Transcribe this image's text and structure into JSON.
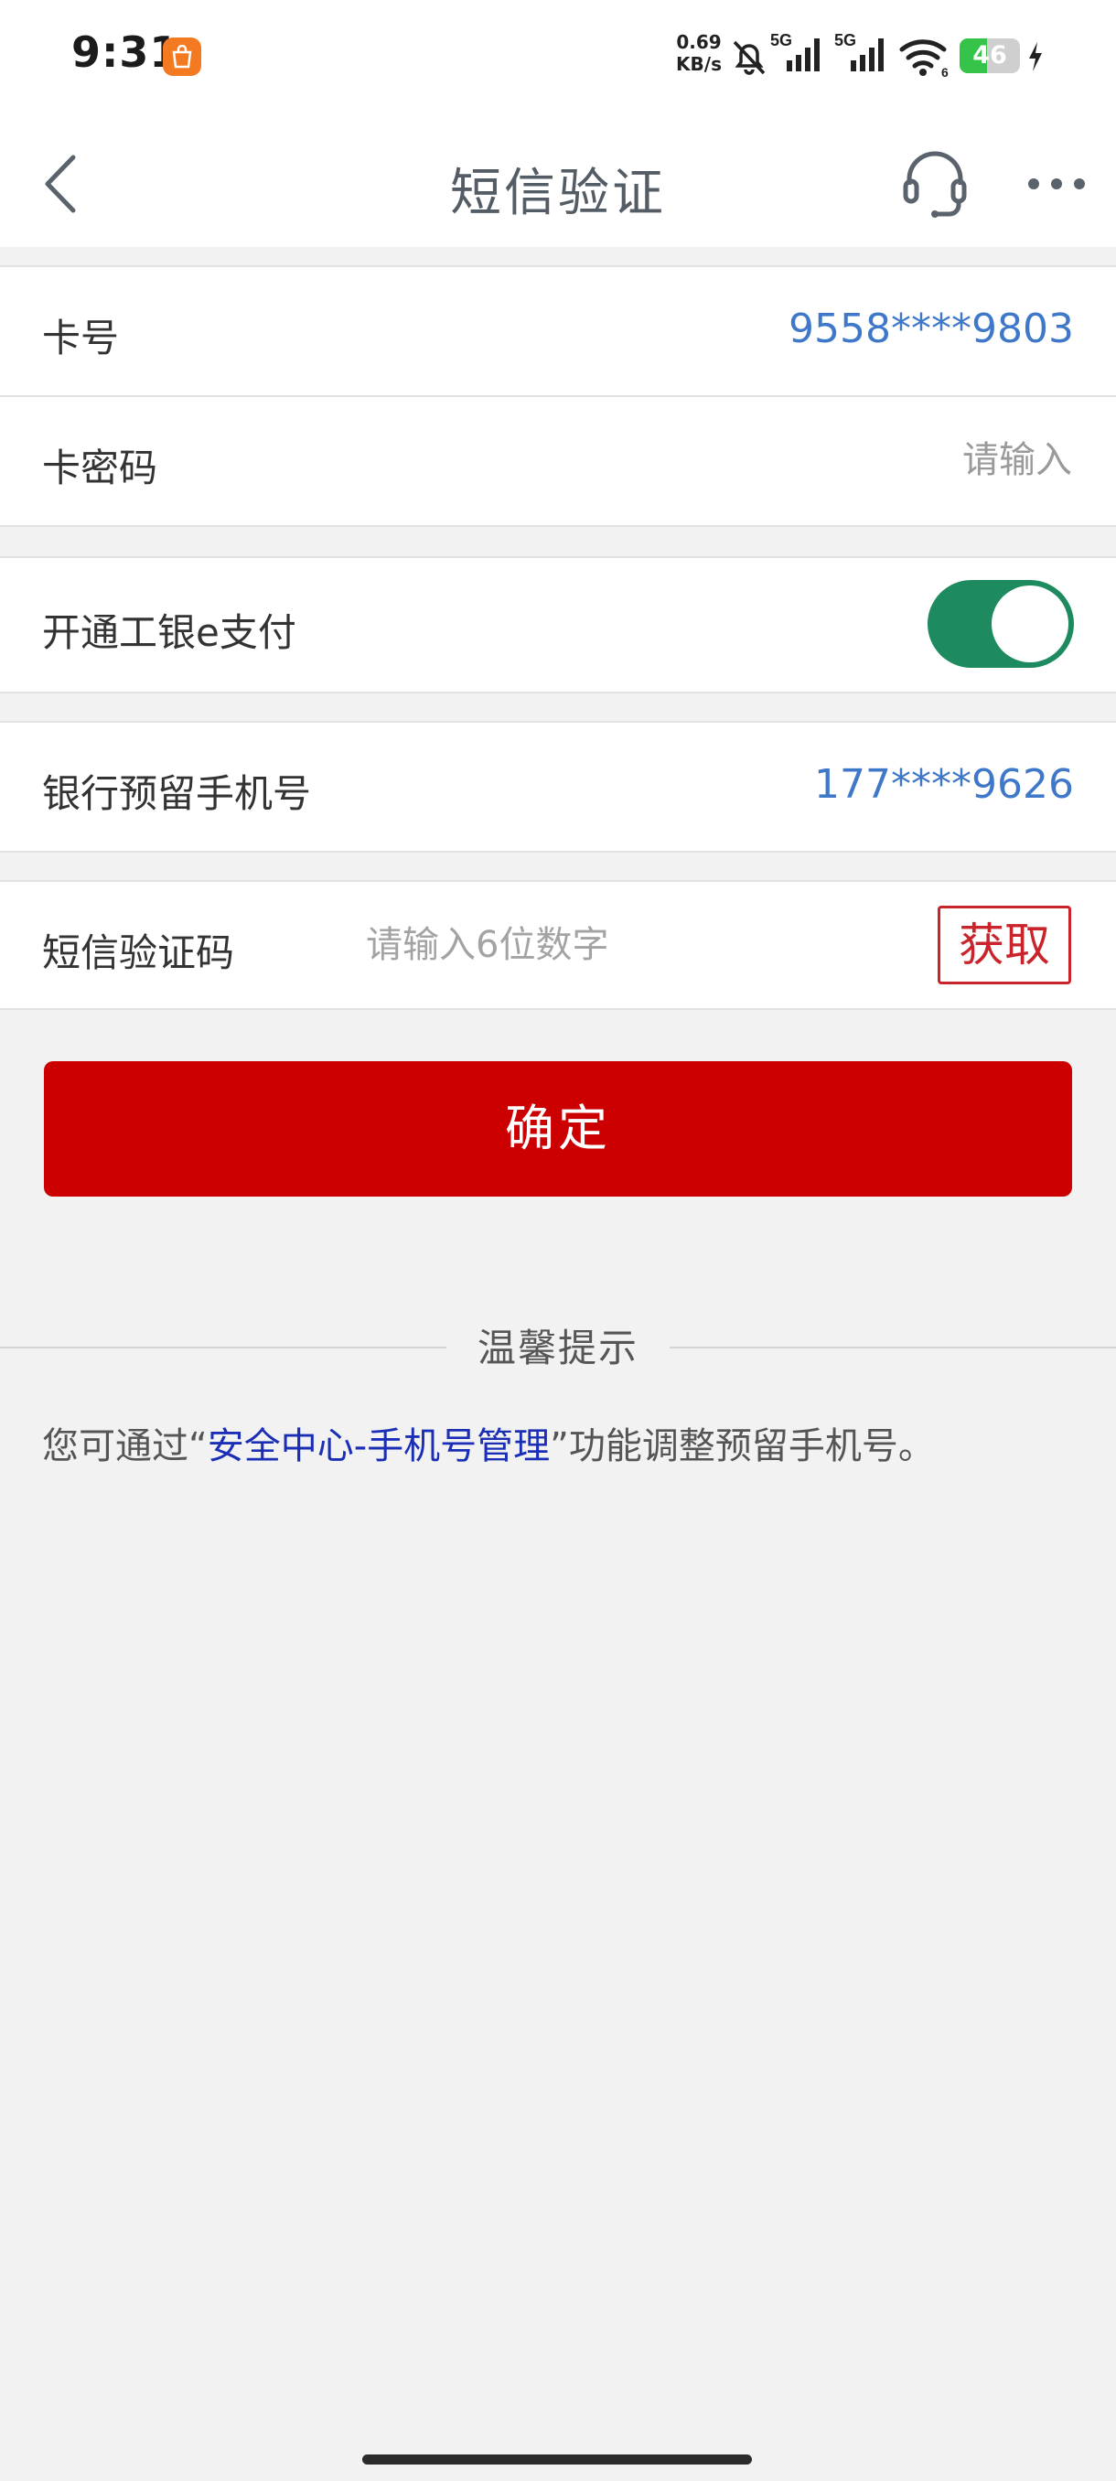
{
  "status_bar": {
    "time": "9:31",
    "net_speed_value": "0.69",
    "net_speed_unit": "KB/s",
    "signal1_label": "5G",
    "signal2_label": "5G",
    "wifi_sub": "6",
    "battery_level": "46",
    "icons": [
      "app-notification-icon",
      "mute-bell-icon",
      "signal-icon",
      "wifi-icon",
      "battery-icon",
      "charging-icon"
    ]
  },
  "nav": {
    "title": "短信验证",
    "icons": [
      "back-arrow-icon",
      "customer-service-headset-icon",
      "more-dots-icon"
    ]
  },
  "card": {
    "number_label": "卡号",
    "number_value": "9558****9803",
    "password_label": "卡密码",
    "password_placeholder": "请输入"
  },
  "epay": {
    "label": "开通工银e支付",
    "enabled": true,
    "toggle_color": "#1e8a5f"
  },
  "phone": {
    "label": "银行预留手机号",
    "value": "177****9626"
  },
  "sms": {
    "label": "短信验证码",
    "placeholder": "请输入6位数字",
    "get_code_label": "获取"
  },
  "confirm_label": "确定",
  "tips": {
    "title": "温馨提示",
    "text_before": "您可通过“",
    "link": "安全中心-手机号管理",
    "text_after": "”功能调整预留手机号。"
  },
  "colors": {
    "accent_red": "#cc0000",
    "link_blue": "#3f78c8",
    "background": "#f2f2f2"
  }
}
